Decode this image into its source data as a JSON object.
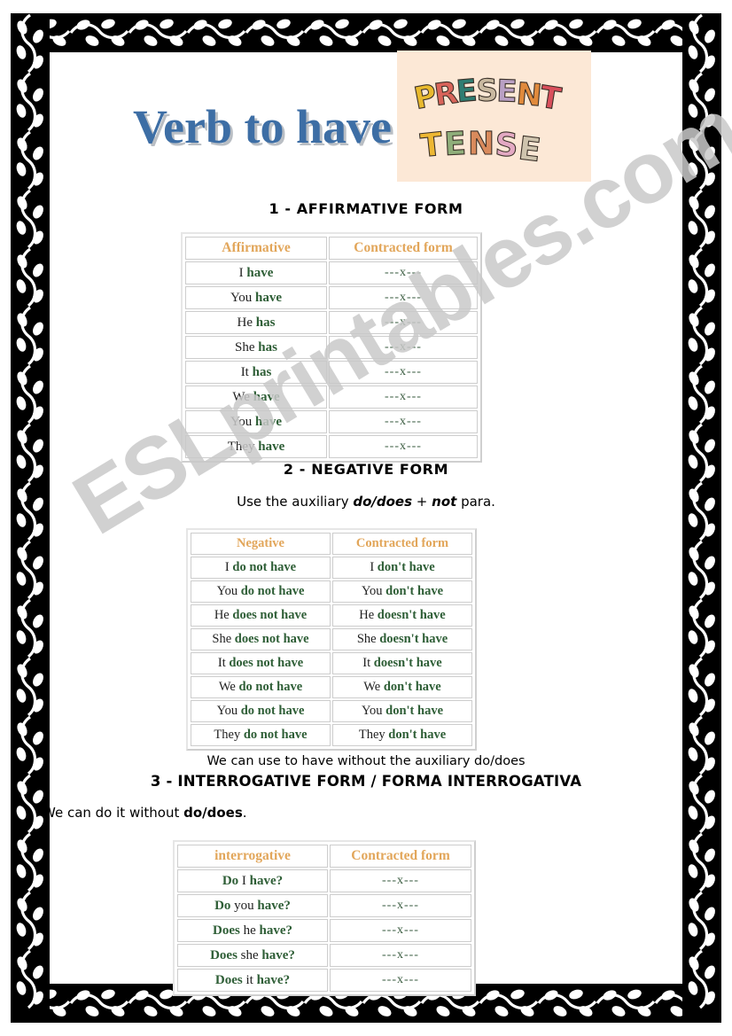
{
  "page": {
    "title": "Verb to have",
    "watermark": "ESLprintables.com",
    "picture_caption": "PRESENT TENSE"
  },
  "sections": {
    "affirmative": {
      "heading": "1 - AFFIRMATIVE FORM",
      "table": {
        "headers": [
          "Affirmative",
          "Contracted form"
        ],
        "rows": [
          {
            "pronoun": "I",
            "verb": "have",
            "contracted": "---x---"
          },
          {
            "pronoun": "You",
            "verb": "have",
            "contracted": "---x---"
          },
          {
            "pronoun": "He",
            "verb": "has",
            "contracted": "---x---"
          },
          {
            "pronoun": "She",
            "verb": "has",
            "contracted": "---x---"
          },
          {
            "pronoun": "It",
            "verb": "has",
            "contracted": "---x---"
          },
          {
            "pronoun": "We",
            "verb": "have",
            "contracted": "---x---"
          },
          {
            "pronoun": "You",
            "verb": "have",
            "contracted": "---x---"
          },
          {
            "pronoun": "They",
            "verb": "have",
            "contracted": "---x---"
          }
        ]
      }
    },
    "negative": {
      "heading": "2 - NEGATIVE FORM",
      "instruction_pre": "Use the auxiliary ",
      "instruction_bold1": "do/does",
      "instruction_mid": " + ",
      "instruction_bold2": "not",
      "instruction_post": " para.",
      "table": {
        "headers": [
          "Negative",
          "Contracted form"
        ],
        "rows": [
          {
            "pronoun": "I",
            "verb": "do not have",
            "c_pronoun": "I",
            "c_verb": "don't have"
          },
          {
            "pronoun": "You",
            "verb": "do not have",
            "c_pronoun": "You",
            "c_verb": "don't have"
          },
          {
            "pronoun": "He",
            "verb": "does not have",
            "c_pronoun": "He",
            "c_verb": "doesn't have"
          },
          {
            "pronoun": "She",
            "verb": "does not have",
            "c_pronoun": "She",
            "c_verb": "doesn't have"
          },
          {
            "pronoun": "It",
            "verb": "does not have",
            "c_pronoun": "It",
            "c_verb": "doesn't have"
          },
          {
            "pronoun": "We",
            "verb": "do not have",
            "c_pronoun": "We",
            "c_verb": "don't have"
          },
          {
            "pronoun": "You",
            "verb": "do not have",
            "c_pronoun": "You",
            "c_verb": "don't have"
          },
          {
            "pronoun": "They",
            "verb": "do not have",
            "c_pronoun": "They",
            "c_verb": "don't have"
          }
        ]
      }
    },
    "interrogative": {
      "note": "We can use to have without the auxiliary do/does",
      "heading": "3 - INTERROGATIVE FORM / FORMA INTERROGATIVA",
      "instruction_pre": "We can do it without  ",
      "instruction_bold": "do/does",
      "instruction_post": ".",
      "table": {
        "headers": [
          "interrogative",
          "Contracted form"
        ],
        "rows": [
          {
            "aux": "Do",
            "pronoun": "I",
            "verb": "have?",
            "contracted": "---x---"
          },
          {
            "aux": "Do",
            "pronoun": "you",
            "verb": "have?",
            "contracted": "---x---"
          },
          {
            "aux": "Does",
            "pronoun": "he",
            "verb": "have?",
            "contracted": "---x---"
          },
          {
            "aux": "Does",
            "pronoun": "she",
            "verb": "have?",
            "contracted": "---x---"
          },
          {
            "aux": "Does",
            "pronoun": "it",
            "verb": "have?",
            "contracted": "---x---"
          }
        ]
      }
    }
  },
  "colors": {
    "title_blue": "#3d6ea5",
    "title_shadow": "#b9bec4",
    "header_orange": "#e2a65a",
    "verb_green": "#2e5e36",
    "watermark_gray": "#c9c9c9",
    "picture_bg": "#fce8d6",
    "border_black": "#000000"
  }
}
